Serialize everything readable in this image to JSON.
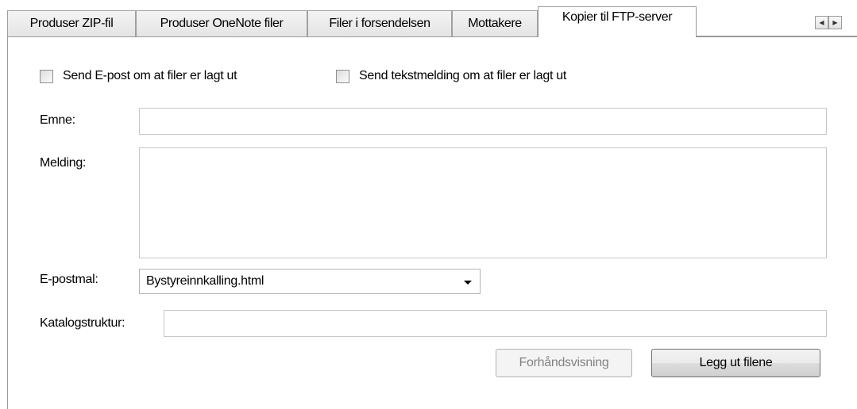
{
  "tabs": [
    {
      "label": "Produser ZIP-fil",
      "active": false
    },
    {
      "label": "Produser OneNote filer",
      "active": false
    },
    {
      "label": "Filer i forsendelsen",
      "active": false
    },
    {
      "label": "Mottakere",
      "active": false
    },
    {
      "label": "Kopier til FTP-server",
      "active": true
    }
  ],
  "tab_scroll": {
    "left_glyph": "◀",
    "right_glyph": "▶"
  },
  "checkboxes": {
    "email": {
      "label": "Send E-post om at filer er lagt ut",
      "checked": false
    },
    "sms": {
      "label": "Send tekstmelding om at filer er lagt ut",
      "checked": false
    }
  },
  "form": {
    "subject_label": "Emne:",
    "subject_value": "",
    "message_label": "Melding:",
    "message_value": "",
    "template_label": "E-postmal:",
    "template_value": "Bystyreinnkalling.html",
    "folder_label": "Katalogstruktur:",
    "folder_value": ""
  },
  "buttons": {
    "preview": "Forhåndsvisning",
    "publish": "Legg ut filene"
  }
}
